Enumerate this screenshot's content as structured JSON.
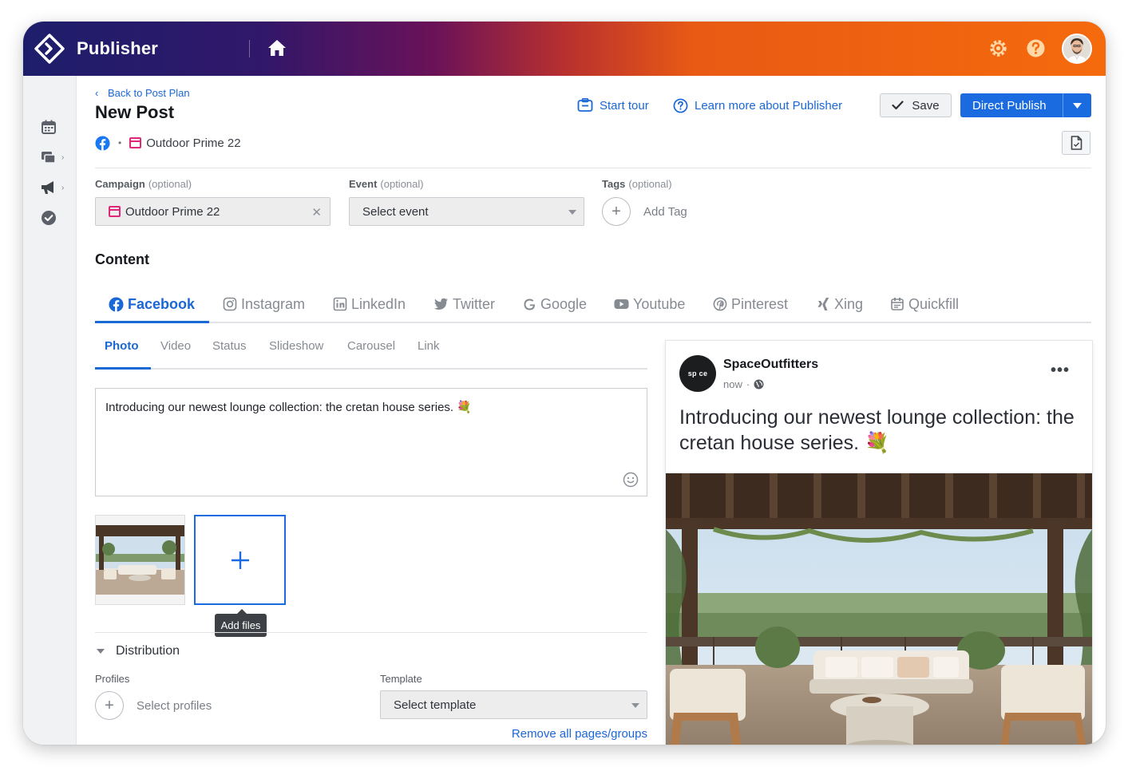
{
  "app": {
    "title": "Publisher"
  },
  "nav": {
    "back_label": "Back to Post Plan",
    "page_title": "New Post",
    "channel_name": "Outdoor Prime 22",
    "separator": "•"
  },
  "actions": {
    "start_tour": "Start tour",
    "learn_more": "Learn more about Publisher",
    "save": "Save",
    "direct_publish": "Direct Publish"
  },
  "fields": {
    "campaign": {
      "label": "Campaign",
      "optional": "(optional)",
      "value": "Outdoor Prime 22"
    },
    "event": {
      "label": "Event",
      "optional": "(optional)",
      "placeholder": "Select event"
    },
    "tags": {
      "label": "Tags",
      "optional": "(optional)",
      "placeholder": "Add Tag"
    }
  },
  "content": {
    "heading": "Content",
    "networks": [
      {
        "label": "Facebook",
        "icon": "facebook-icon",
        "active": true
      },
      {
        "label": "Instagram",
        "icon": "instagram-icon"
      },
      {
        "label": "LinkedIn",
        "icon": "linkedin-icon"
      },
      {
        "label": "Twitter",
        "icon": "twitter-icon"
      },
      {
        "label": "Google",
        "icon": "google-icon"
      },
      {
        "label": "Youtube",
        "icon": "youtube-icon"
      },
      {
        "label": "Pinterest",
        "icon": "pinterest-icon"
      },
      {
        "label": "Xing",
        "icon": "xing-icon"
      },
      {
        "label": "Quickfill",
        "icon": "quickfill-icon"
      }
    ],
    "post_types": [
      {
        "label": "Photo",
        "active": true
      },
      {
        "label": "Video"
      },
      {
        "label": "Status"
      },
      {
        "label": "Slideshow"
      },
      {
        "label": "Carousel"
      },
      {
        "label": "Link"
      }
    ],
    "post_text": "Introducing our newest lounge collection: the cretan house series. 💐",
    "add_files_tooltip": "Add files"
  },
  "distribution": {
    "label": "Distribution",
    "profiles_label": "Profiles",
    "profiles_placeholder": "Select profiles",
    "template_label": "Template",
    "template_placeholder": "Select template",
    "remove_link": "Remove all pages/groups"
  },
  "preview": {
    "page_name": "SpaceOutfitters",
    "avatar_text": "sp ce",
    "time": "now",
    "time_separator": "·",
    "text": "Introducing our newest lounge collection: the cretan house series. 💐"
  },
  "colors": {
    "accent": "#1a67d6",
    "primary_button": "#1a6be0",
    "campaign": "#e0287a",
    "facebook": "#1877f2"
  }
}
